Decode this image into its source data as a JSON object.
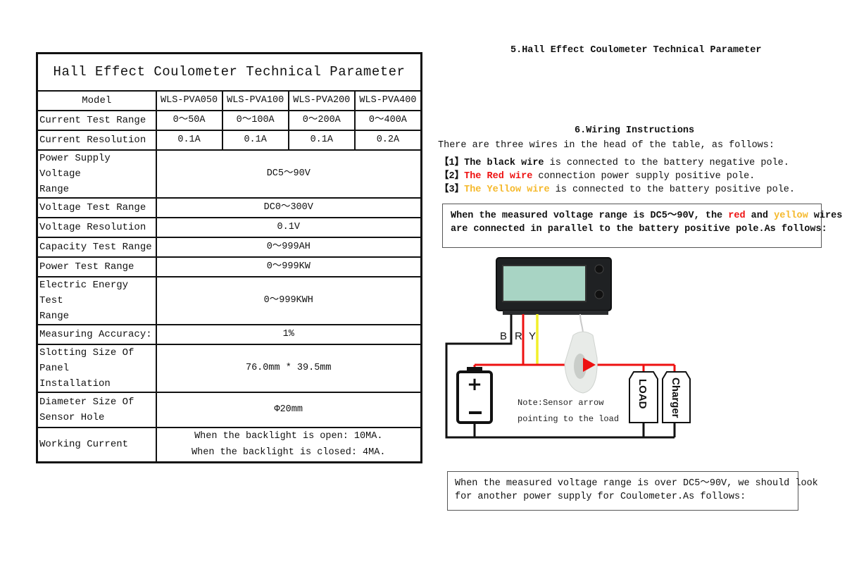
{
  "table": {
    "title": "Hall Effect Coulometer Technical Parameter",
    "header": {
      "label": "Model",
      "models": [
        "WLS-PVA050",
        "WLS-PVA100",
        "WLS-PVA200",
        "WLS-PVA400"
      ]
    },
    "per_model_rows": [
      {
        "label": "Current Test Range",
        "values": [
          "0～50A",
          "0～100A",
          "0～200A",
          "0～400A"
        ]
      },
      {
        "label": "Current Resolution",
        "values": [
          "0.1A",
          "0.1A",
          "0.1A",
          "0.2A"
        ]
      }
    ],
    "shared_rows": [
      {
        "label_line1": "Power Supply Voltage",
        "label_line2": "Range",
        "value": "DC5～90V"
      },
      {
        "label_line1": "Voltage Test Range",
        "label_line2": "",
        "value": "DC0～300V"
      },
      {
        "label_line1": "Voltage Resolution",
        "label_line2": "",
        "value": "0.1V"
      },
      {
        "label_line1": "Capacity Test Range",
        "label_line2": "",
        "value": "0～999AH"
      },
      {
        "label_line1": "Power Test Range",
        "label_line2": "",
        "value": "0～999KW"
      },
      {
        "label_line1": "Electric Energy Test",
        "label_line2": "Range",
        "value": "0～999KWH"
      },
      {
        "label_line1": "Measuring Accuracy:",
        "label_line2": "",
        "value": "1%"
      },
      {
        "label_line1": "Slotting Size Of Panel",
        "label_line2": "Installation",
        "value": "76.0mm * 39.5mm"
      },
      {
        "label_line1": "Diameter Size Of",
        "label_line2": "Sensor Hole",
        "value": "Φ20mm"
      }
    ],
    "working_current": {
      "label": "Working Current",
      "line1": "When the backlight is open: 10MA.",
      "line2": "When the backlight is closed: 4MA."
    }
  },
  "section5": {
    "heading": "5.Hall Effect Coulometer Technical Parameter"
  },
  "section6": {
    "heading": "6.Wiring Instructions",
    "intro": "There are three wires in the head of the table, as follows:",
    "wires": [
      {
        "index": "【1】",
        "name": "The black wire",
        "text": " is connected to the battery negative pole.",
        "color": "#111111"
      },
      {
        "index": "【2】",
        "name": "The Red wire",
        "text": " connection power supply positive pole.",
        "color": "#ee1111"
      },
      {
        "index": "【3】",
        "name": "The Yellow wire",
        "text": " is connected to the battery positive pole.",
        "color": "#f5b82a"
      }
    ]
  },
  "note_parallel": {
    "p1": "When the measured voltage range is DC5～90V, the ",
    "red": "red",
    "p2": " and ",
    "yellow": "yellow",
    "p3": " wires",
    "line2": "are connected in parallel to the battery positive pole.As follows:"
  },
  "diagram": {
    "wire_labels": [
      "B",
      "R",
      "Y"
    ],
    "note_line1": "Note:Sensor arrow",
    "note_line2": "pointing to the load",
    "load_label": "LOAD",
    "charger_label": "Charger",
    "battery_plus": "+",
    "battery_minus": "−",
    "colors": {
      "black": "#111111",
      "red": "#ee1111",
      "yellow": "#f2ef2a",
      "lcd": "#a8d4c4",
      "sensor": "#e8ebe8"
    }
  },
  "note_other": {
    "line1": "When the measured voltage range is over DC5～90V, we should  look",
    "line2": "for another power supply for Coulometer.As follows:"
  }
}
